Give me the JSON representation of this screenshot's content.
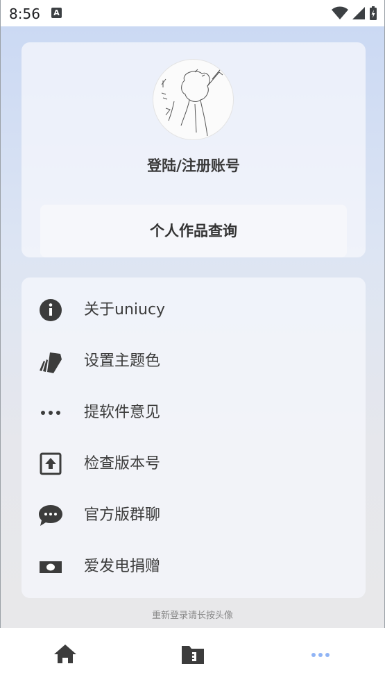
{
  "status_bar": {
    "time": "8:56",
    "notification_icon": "A"
  },
  "profile": {
    "login_text": "登陆/注册账号",
    "works_button": "个人作品查询"
  },
  "menu": {
    "items": [
      {
        "label": "关于uniucy",
        "icon": "info-icon"
      },
      {
        "label": "设置主题色",
        "icon": "palette-cards-icon"
      },
      {
        "label": "提软件意见",
        "icon": "more-dots-icon"
      },
      {
        "label": "检查版本号",
        "icon": "upload-box-icon"
      },
      {
        "label": "官方版群聊",
        "icon": "chat-bubble-icon"
      },
      {
        "label": "爱发电捐赠",
        "icon": "money-icon"
      }
    ]
  },
  "footer_hint": "重新登录请长按头像",
  "colors": {
    "accent": "#90b4f5",
    "icon": "#3c3c3c",
    "text": "#3a3a3a"
  },
  "tabs": [
    {
      "name": "home",
      "icon": "home-icon",
      "active": false
    },
    {
      "name": "files",
      "icon": "folder-icon",
      "active": false
    },
    {
      "name": "more",
      "icon": "more-dots-icon",
      "active": true
    }
  ]
}
